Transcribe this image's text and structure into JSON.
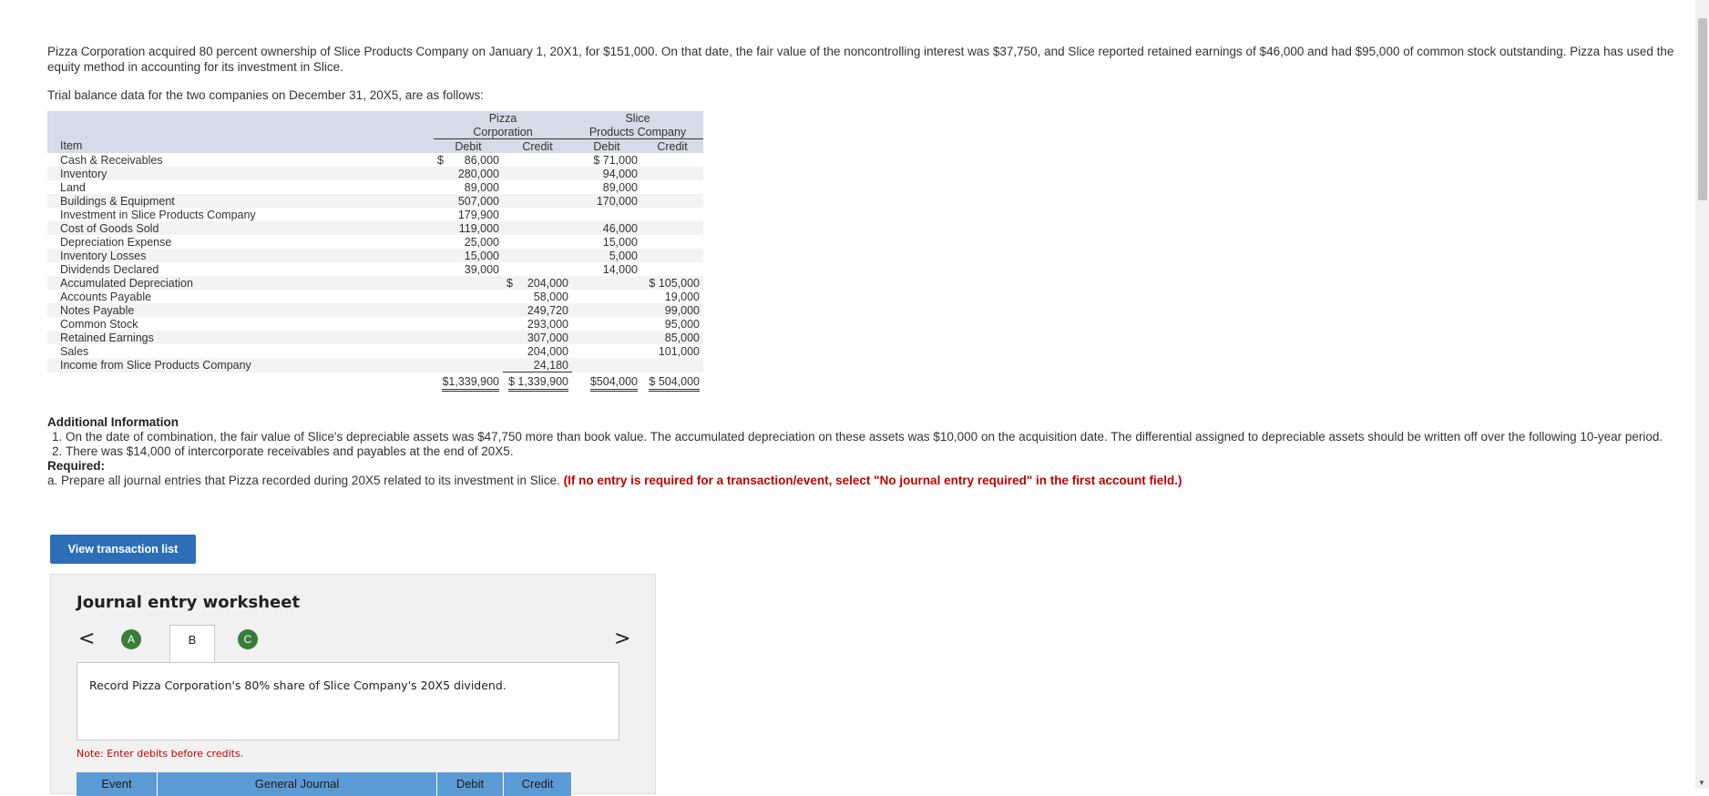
{
  "intro": {
    "paragraph": "Pizza Corporation acquired 80 percent ownership of Slice Products Company on January 1, 20X1, for $151,000. On that date, the fair value of the noncontrolling interest was $37,750, and Slice reported retained earnings of $46,000 and had $95,000 of common stock outstanding. Pizza has used the equity method in accounting for its investment in Slice.",
    "trial_label": "Trial balance data for the two companies on December 31, 20X5, are as follows:"
  },
  "trial_balance": {
    "pizza_line1": "Pizza",
    "pizza_line2": "Corporation",
    "slice_line1": "Slice",
    "slice_line2": "Products Company",
    "item_header": "Item",
    "debit": "Debit",
    "credit": "Credit",
    "rows": [
      {
        "item": "Cash & Receivables",
        "p_cur": "$",
        "p_debit": "86,000",
        "p_credit_cur": "",
        "p_credit": "",
        "s_debit": "$ 71,000",
        "s_credit": ""
      },
      {
        "item": "Inventory",
        "p_cur": "",
        "p_debit": "280,000",
        "p_credit_cur": "",
        "p_credit": "",
        "s_debit": "94,000",
        "s_credit": ""
      },
      {
        "item": "Land",
        "p_cur": "",
        "p_debit": "89,000",
        "p_credit_cur": "",
        "p_credit": "",
        "s_debit": "89,000",
        "s_credit": ""
      },
      {
        "item": "Buildings & Equipment",
        "p_cur": "",
        "p_debit": "507,000",
        "p_credit_cur": "",
        "p_credit": "",
        "s_debit": "170,000",
        "s_credit": ""
      },
      {
        "item": "Investment in Slice Products Company",
        "p_cur": "",
        "p_debit": "179,900",
        "p_credit_cur": "",
        "p_credit": "",
        "s_debit": "",
        "s_credit": ""
      },
      {
        "item": "Cost of Goods Sold",
        "p_cur": "",
        "p_debit": "119,000",
        "p_credit_cur": "",
        "p_credit": "",
        "s_debit": "46,000",
        "s_credit": ""
      },
      {
        "item": "Depreciation Expense",
        "p_cur": "",
        "p_debit": "25,000",
        "p_credit_cur": "",
        "p_credit": "",
        "s_debit": "15,000",
        "s_credit": ""
      },
      {
        "item": "Inventory Losses",
        "p_cur": "",
        "p_debit": "15,000",
        "p_credit_cur": "",
        "p_credit": "",
        "s_debit": "5,000",
        "s_credit": ""
      },
      {
        "item": "Dividends Declared",
        "p_cur": "",
        "p_debit": "39,000",
        "p_credit_cur": "",
        "p_credit": "",
        "s_debit": "14,000",
        "s_credit": ""
      },
      {
        "item": "Accumulated Depreciation",
        "p_cur": "",
        "p_debit": "",
        "p_credit_cur": "$",
        "p_credit": "204,000",
        "s_debit": "",
        "s_credit": "$ 105,000"
      },
      {
        "item": "Accounts Payable",
        "p_cur": "",
        "p_debit": "",
        "p_credit_cur": "",
        "p_credit": "58,000",
        "s_debit": "",
        "s_credit": "19,000"
      },
      {
        "item": "Notes Payable",
        "p_cur": "",
        "p_debit": "",
        "p_credit_cur": "",
        "p_credit": "249,720",
        "s_debit": "",
        "s_credit": "99,000"
      },
      {
        "item": "Common Stock",
        "p_cur": "",
        "p_debit": "",
        "p_credit_cur": "",
        "p_credit": "293,000",
        "s_debit": "",
        "s_credit": "95,000"
      },
      {
        "item": "Retained Earnings",
        "p_cur": "",
        "p_debit": "",
        "p_credit_cur": "",
        "p_credit": "307,000",
        "s_debit": "",
        "s_credit": "85,000"
      },
      {
        "item": "Sales",
        "p_cur": "",
        "p_debit": "",
        "p_credit_cur": "",
        "p_credit": "204,000",
        "s_debit": "",
        "s_credit": "101,000"
      },
      {
        "item": "Income from Slice Products Company",
        "p_cur": "",
        "p_debit": "",
        "p_credit_cur": "",
        "p_credit": "24,180",
        "s_debit": "",
        "s_credit": ""
      }
    ],
    "totals": {
      "p_debit": "$1,339,900",
      "p_credit": "$ 1,339,900",
      "s_debit": "$504,000",
      "s_credit": "$ 504,000"
    }
  },
  "additional": {
    "heading": "Additional Information",
    "items": [
      "On the date of combination, the fair value of Slice's depreciable assets was $47,750 more than book value. The accumulated depreciation on these assets was $10,000 on the acquisition date. The differential assigned to depreciable assets should be written off over the following 10-year period.",
      "There was $14,000 of intercorporate receivables and payables at the end of 20X5."
    ],
    "required_heading": "Required:",
    "required_text": "a. Prepare all journal entries that Pizza recorded during 20X5 related to its investment in Slice.",
    "required_note": "(If no entry is required for a transaction/event, select \"No journal entry required\" in the first account field.)"
  },
  "view_button": "View transaction list",
  "worksheet": {
    "title": "Journal entry worksheet",
    "tab_a": "A",
    "tab_b": "B",
    "tab_c": "C",
    "prev": "<",
    "next": ">",
    "description": "Record Pizza Corporation's 80% share of Slice Company's 20X5 dividend.",
    "note": "Note: Enter debits before credits.",
    "columns": [
      "Event",
      "General Journal",
      "Debit",
      "Credit"
    ]
  },
  "colors": {
    "header_band": "#d5dbe8",
    "button_blue": "#2d6fb7",
    "tab_green": "#3a7d3a",
    "note_red": "#c00000",
    "journal_header": "#5b9bd5"
  }
}
